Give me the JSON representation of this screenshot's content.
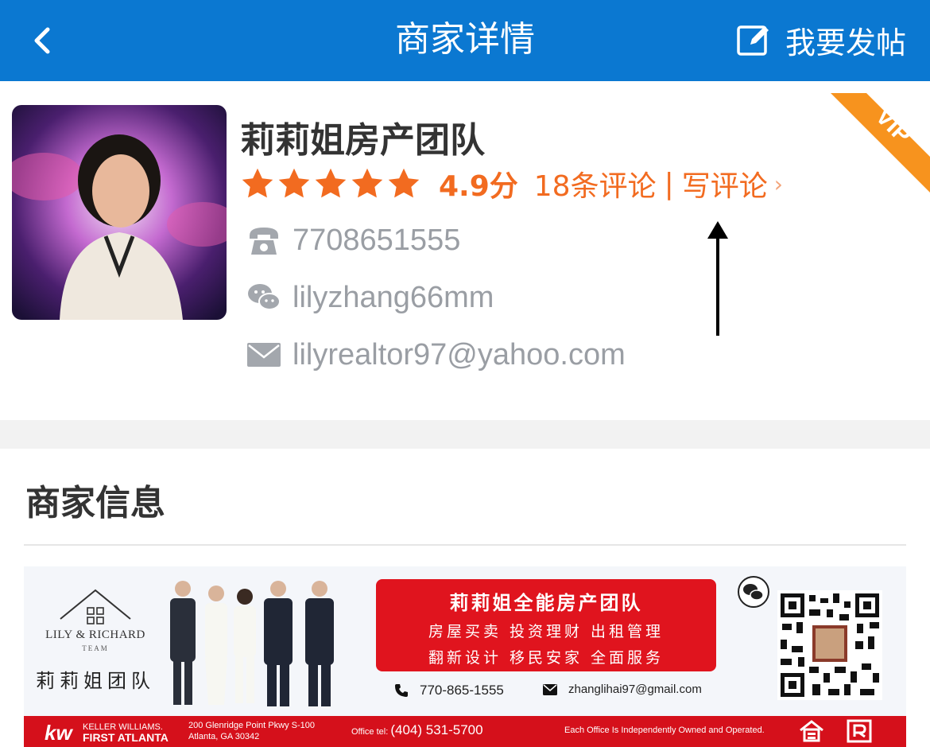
{
  "header": {
    "title": "商家详情",
    "post_label": "我要发帖"
  },
  "profile": {
    "name": "莉莉姐房产团队",
    "rating": "4.9分",
    "stars": 5,
    "reviews_link": "18条评论",
    "separator": "|",
    "write_review": "写评论",
    "chevron": "›",
    "phone": "7708651555",
    "wechat": "lilyzhang66mm",
    "email": "lilyrealtor97@yahoo.com",
    "vip_badge": "VIP"
  },
  "merchant_info": {
    "section_title": "商家信息",
    "banner": {
      "logo_name": "LILY & RICHARD",
      "logo_team": "TEAM",
      "logo_cn": "莉莉姐团队",
      "headline": "莉莉姐全能房产团队",
      "services_line1": "房屋买卖 投资理财 出租管理",
      "services_line2": "翻新设计 移民安家 全面服务",
      "phone": "770-865-1555",
      "email": "zhanglihai97@gmail.com",
      "brand_kw": "kw",
      "brand_name": "KELLER WILLIAMS.",
      "brand_office": "FIRST ATLANTA",
      "address_line1": "200 Glenridge Point Pkwy S-100",
      "address_line2": "Atlanta, GA 30342",
      "office_label": "Office tel:",
      "office_tel": "(404) 531-5700",
      "disclaimer": "Each Office Is Independently Owned and Operated."
    }
  },
  "colors": {
    "header_blue": "#0b78d1",
    "accent_orange": "#f26b20",
    "banner_red": "#e0141e",
    "footer_red": "#d5101b",
    "muted_gray": "#9a9ea4"
  },
  "icons": [
    "back-arrow-icon",
    "edit-icon",
    "star-icon",
    "phone-icon",
    "wechat-icon",
    "mail-icon",
    "vip-ribbon-icon",
    "qr-code"
  ]
}
